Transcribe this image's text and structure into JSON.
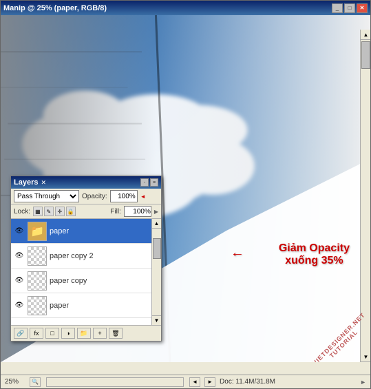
{
  "window": {
    "title": "Manip @ 25% (paper, RGB/8)",
    "title_btns": [
      "_",
      "□",
      "✕"
    ]
  },
  "annotation": {
    "line1": "Giảm Opacity",
    "line2": "xuống 35%"
  },
  "layers_panel": {
    "title": "Layers",
    "close_btn": "x",
    "min_btn": "-",
    "menu_btn": "≡",
    "blend_mode": "Pass Through",
    "opacity_label": "Opacity:",
    "opacity_value": "100%",
    "lock_label": "Lock:",
    "fill_label": "Fill:",
    "fill_value": "100%",
    "layers": [
      {
        "name": "paper",
        "type": "folder",
        "selected": true
      },
      {
        "name": "paper copy 2",
        "type": "checkered",
        "selected": false
      },
      {
        "name": "paper copy",
        "type": "checkered",
        "selected": false
      },
      {
        "name": "paper",
        "type": "checkered",
        "selected": false
      }
    ],
    "toolbar_btns": [
      "🔗",
      "fx",
      "🖼",
      "✎",
      "⊕",
      "🗑"
    ]
  },
  "status_bar": {
    "zoom": "25%",
    "doc_label": "Doc: 11.4M/31.8M"
  },
  "watermark": {
    "line1": "VIETDESIGNER.NET",
    "line2": "TUTORIAL"
  }
}
